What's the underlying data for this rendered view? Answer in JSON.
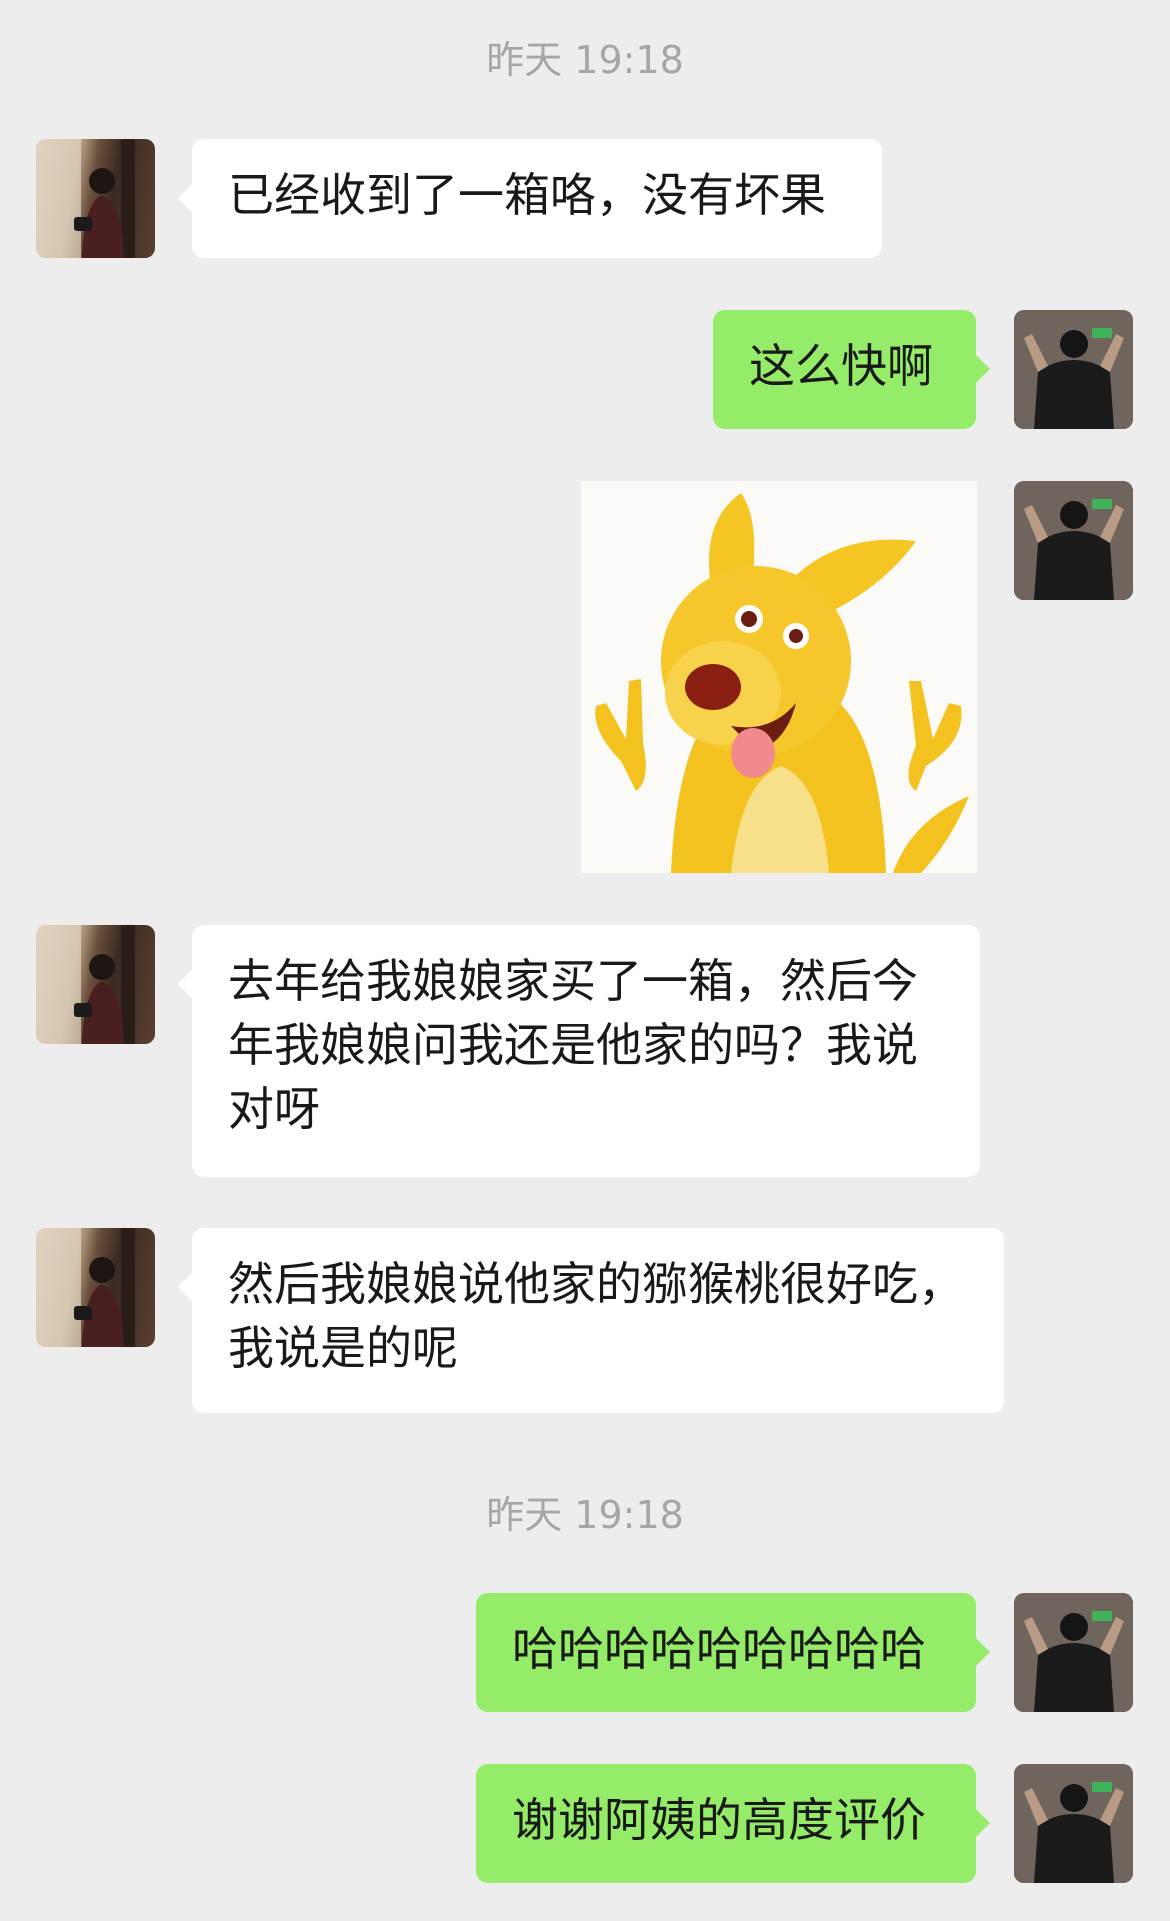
{
  "timestamps": [
    "昨天 19:18",
    "昨天 19:18"
  ],
  "messages": [
    {
      "side": "left",
      "text": "已经收到了一箱咯，没有坏果"
    },
    {
      "side": "right",
      "text": "这么快啊"
    },
    {
      "side": "right",
      "type": "sticker",
      "sticker": "yellow-kangaroo-peace-sign-sticker"
    },
    {
      "side": "left",
      "text": "去年给我娘娘家买了一箱，然后今年我娘娘问我还是他家的吗？我说对呀"
    },
    {
      "side": "left",
      "text": "然后我娘娘说他家的猕猴桃很好吃，我说是的呢"
    },
    {
      "side": "right",
      "text": "哈哈哈哈哈哈哈哈哈"
    },
    {
      "side": "right",
      "text": "谢谢阿姨的高度评价"
    }
  ],
  "colors": {
    "background": "#ededed",
    "incoming_bubble": "#ffffff",
    "outgoing_bubble": "#95ec69",
    "timestamp_text": "#a6a6a6"
  }
}
